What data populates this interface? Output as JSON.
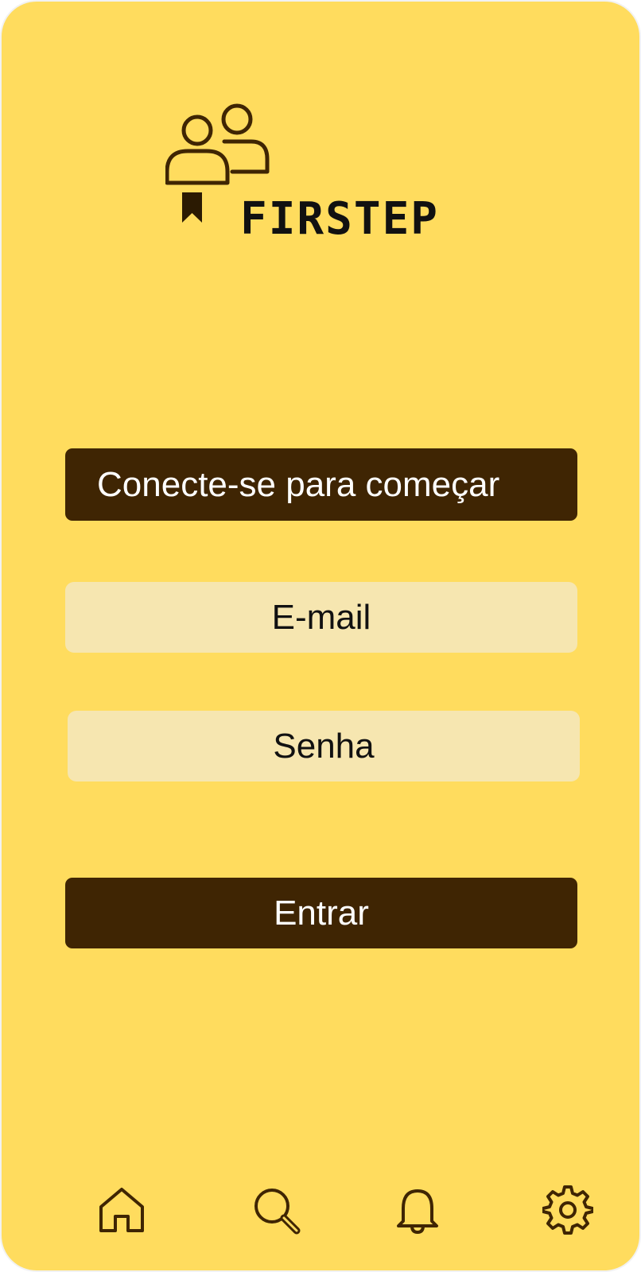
{
  "colors": {
    "background": "#FFDC5E",
    "dark_brown": "#3F2503",
    "field_fill": "#F6E6B0",
    "icon_stroke": "#3F2503"
  },
  "brand": {
    "name": "FIRSTEP",
    "logo_icon": "two-people-ribbon-icon"
  },
  "login": {
    "banner_label": "Conecte-se para começar",
    "email_placeholder": "E-mail",
    "password_placeholder": "Senha",
    "submit_label": "Entrar"
  },
  "bottom_nav": {
    "items": [
      {
        "icon": "home-icon"
      },
      {
        "icon": "search-icon"
      },
      {
        "icon": "bell-icon"
      },
      {
        "icon": "gear-icon"
      }
    ]
  }
}
